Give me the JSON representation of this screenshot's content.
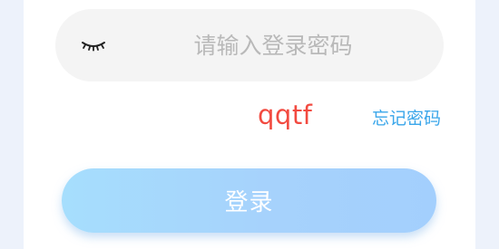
{
  "password": {
    "value": "",
    "placeholder": "请输入登录密码",
    "icon": "eye-closed-icon"
  },
  "captcha": {
    "text": "qqtf",
    "color": "#f24a40"
  },
  "forgot_password": {
    "label": "忘记密码",
    "color": "#3aa6ea"
  },
  "login_button": {
    "label": "登录"
  },
  "colors": {
    "background": "#edf2fb",
    "card": "#ffffff",
    "field": "#f4f4f4",
    "button_gradient_start": "#a6defd",
    "button_gradient_end": "#a3cffd"
  }
}
